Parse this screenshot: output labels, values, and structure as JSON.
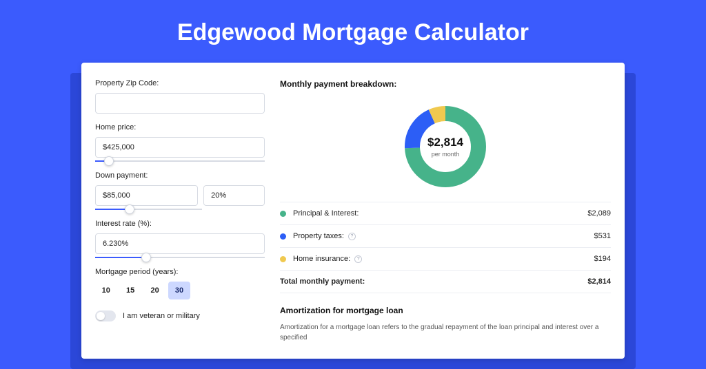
{
  "title": "Edgewood Mortgage Calculator",
  "form": {
    "zip": {
      "label": "Property Zip Code:",
      "value": ""
    },
    "price": {
      "label": "Home price:",
      "value": "$425,000",
      "slider_pct": 8
    },
    "down": {
      "label": "Down payment:",
      "amount": "$85,000",
      "pct": "20%",
      "slider_pct": 20
    },
    "rate": {
      "label": "Interest rate (%):",
      "value": "6.230%",
      "slider_pct": 30
    },
    "period": {
      "label": "Mortgage period (years):",
      "options": [
        "10",
        "15",
        "20",
        "30"
      ],
      "selected": "30"
    },
    "veteran": {
      "label": "I am veteran or military",
      "checked": false
    }
  },
  "breakdown": {
    "heading": "Monthly payment breakdown:",
    "center_value": "$2,814",
    "center_sub": "per month",
    "items": [
      {
        "label": "Principal & Interest:",
        "value": "$2,089",
        "color": "green",
        "info": false
      },
      {
        "label": "Property taxes:",
        "value": "$531",
        "color": "blue",
        "info": true
      },
      {
        "label": "Home insurance:",
        "value": "$194",
        "color": "yellow",
        "info": true
      }
    ],
    "total": {
      "label": "Total monthly payment:",
      "value": "$2,814"
    }
  },
  "amort": {
    "title": "Amortization for mortgage loan",
    "text": "Amortization for a mortgage loan refers to the gradual repayment of the loan principal and interest over a specified"
  },
  "chart_data": {
    "type": "pie",
    "title": "Monthly payment breakdown",
    "series": [
      {
        "name": "Principal & Interest",
        "value": 2089,
        "color": "#46b38a"
      },
      {
        "name": "Property taxes",
        "value": 531,
        "color": "#2c5ef6"
      },
      {
        "name": "Home insurance",
        "value": 194,
        "color": "#f0c94f"
      }
    ],
    "total": 2814,
    "unit": "USD/month"
  }
}
